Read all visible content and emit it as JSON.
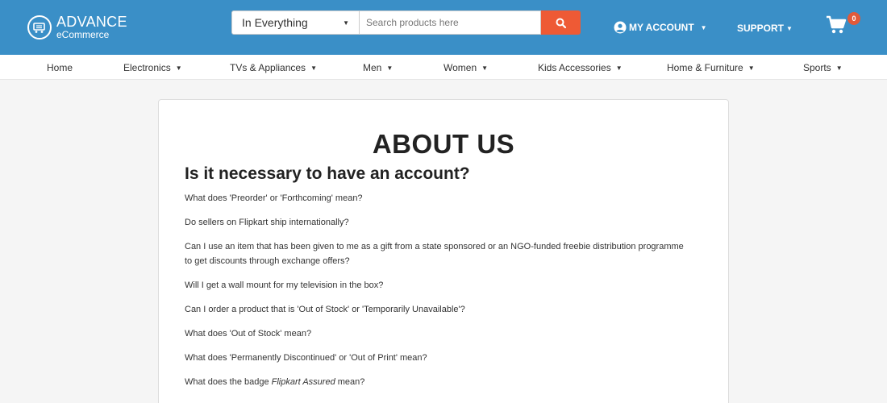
{
  "header": {
    "logo_title": "ADVANCE",
    "logo_sub": "eCommerce",
    "search_category": "In Everything",
    "search_placeholder": "Search products here",
    "account_label": "MY ACCOUNT",
    "support_label": "SUPPORT",
    "cart_count": "0",
    "icons": {
      "logo": "cart-logo-icon",
      "search": "search-icon",
      "account": "user-circle-icon",
      "cart": "shopping-cart-icon"
    },
    "colors": {
      "topbar": "#3a8fc7",
      "search_button": "#ee5a35",
      "badge": "#e05a3a"
    }
  },
  "nav": {
    "items": [
      {
        "label": "Home"
      },
      {
        "label": "Electronics"
      },
      {
        "label": "TVs & Appliances"
      },
      {
        "label": "Men"
      },
      {
        "label": "Women"
      },
      {
        "label": "Kids Accessories"
      },
      {
        "label": "Home & Furniture"
      },
      {
        "label": "Sports"
      }
    ]
  },
  "content": {
    "title": "ABOUT US",
    "subtitle": "Is it necessary to have an account?",
    "questions": [
      "What does 'Preorder' or 'Forthcoming' mean?",
      "Do sellers on Flipkart ship internationally?",
      "Can I use an item that has been given to me as a gift from a state sponsored or an NGO-funded freebie distribution programme to get discounts through exchange offers?",
      "Will I get a wall mount for my television in the box?",
      "Can I order a product that is 'Out of Stock' or 'Temporarily Unavailable'?",
      "What does 'Out of Stock' mean?",
      "What does 'Permanently Discontinued' or 'Out of Print' mean?"
    ],
    "last_question_prefix": "What does the badge ",
    "last_question_em": "Flipkart Assured",
    "last_question_suffix": " mean?"
  }
}
